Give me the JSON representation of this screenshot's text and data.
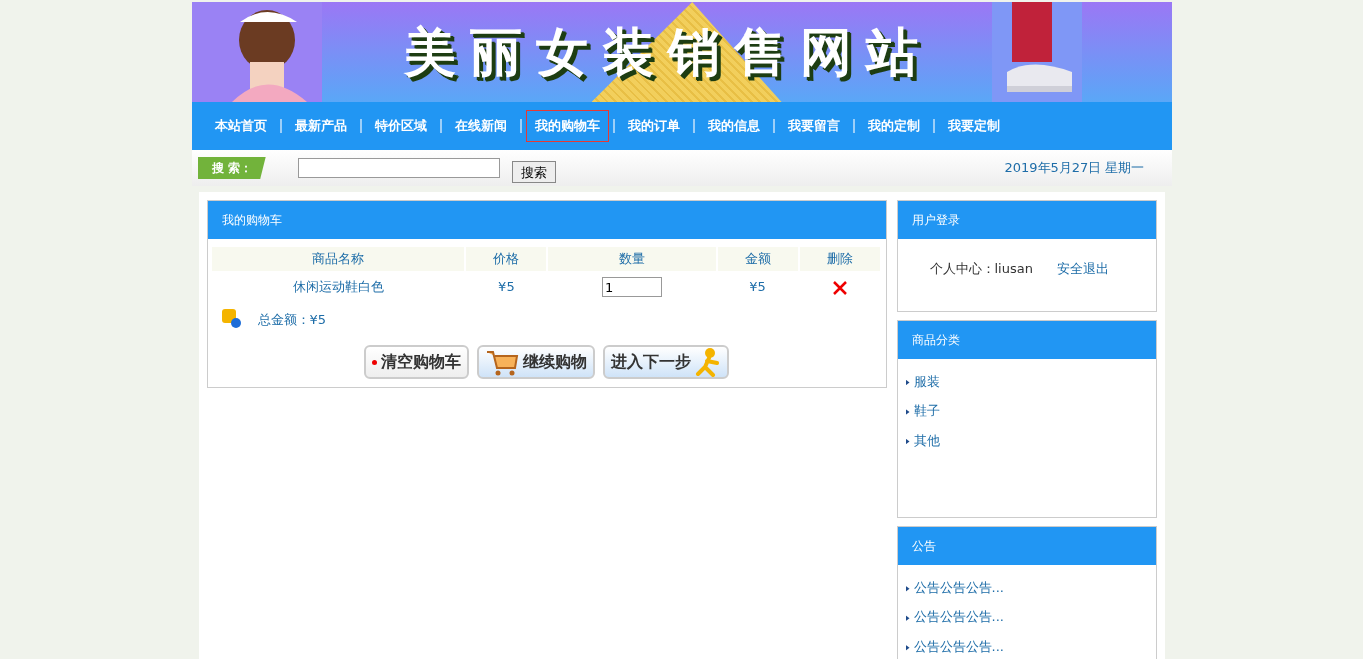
{
  "banner": {
    "title": "美丽女装销售网站"
  },
  "nav": [
    {
      "label": "本站首页",
      "selected": false
    },
    {
      "label": "最新产品",
      "selected": false
    },
    {
      "label": "特价区域",
      "selected": false
    },
    {
      "label": "在线新闻",
      "selected": false
    },
    {
      "label": "我的购物车",
      "selected": true
    },
    {
      "label": "我的订单",
      "selected": false
    },
    {
      "label": "我的信息",
      "selected": false
    },
    {
      "label": "我要留言",
      "selected": false
    },
    {
      "label": "我的定制",
      "selected": false
    },
    {
      "label": "我要定制",
      "selected": false
    }
  ],
  "search": {
    "label": "搜 索：",
    "button": "搜索",
    "date": "2019年5月27日  星期一"
  },
  "cart": {
    "title": "我的购物车",
    "columns": [
      "商品名称",
      "价格",
      "数量",
      "金额",
      "删除"
    ],
    "rows": [
      {
        "name": "休闲运动鞋白色",
        "price": "¥5",
        "quantity": "1",
        "amount": "¥5"
      }
    ],
    "total": "总金额：¥5",
    "buttons": [
      {
        "kind": "clear",
        "label": "清空购物车"
      },
      {
        "kind": "continue",
        "label": "继续购物"
      },
      {
        "kind": "next",
        "label": "进入下一步"
      }
    ]
  },
  "login": {
    "title": "用户登录",
    "center_label": "个人中心：",
    "username": "liusan",
    "logout": "安全退出"
  },
  "categories": {
    "title": "商品分类",
    "items": [
      "服装",
      "鞋子",
      "其他"
    ]
  },
  "notices": {
    "title": "公告",
    "items": [
      "公告公告公告...",
      "公告公告公告...",
      "公告公告公告..."
    ]
  }
}
